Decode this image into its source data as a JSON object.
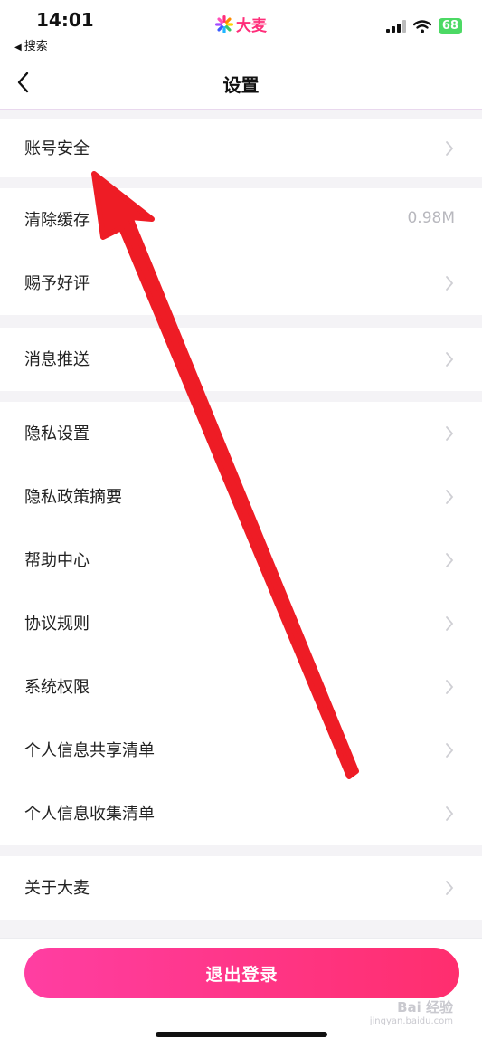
{
  "status_bar": {
    "time": "14:01",
    "back_app": "搜索",
    "battery": "68",
    "brand": "大麦"
  },
  "nav": {
    "title": "设置"
  },
  "sections": [
    {
      "items": [
        {
          "label": "账号安全"
        }
      ]
    },
    {
      "items": [
        {
          "label": "清除缓存",
          "value": "0.98M"
        },
        {
          "label": "赐予好评"
        }
      ]
    },
    {
      "items": [
        {
          "label": "消息推送"
        }
      ]
    },
    {
      "items": [
        {
          "label": "隐私设置"
        },
        {
          "label": "隐私政策摘要"
        },
        {
          "label": "帮助中心"
        },
        {
          "label": "协议规则"
        },
        {
          "label": "系统权限"
        },
        {
          "label": "个人信息共享清单"
        },
        {
          "label": "个人信息收集清单"
        }
      ]
    },
    {
      "items": [
        {
          "label": "关于大麦"
        }
      ]
    }
  ],
  "logout": {
    "label": "退出登录"
  },
  "watermark": {
    "main": "Bai 经验",
    "sub": "jingyan.baidu.com"
  },
  "colors": {
    "accent": "#ff2e7a",
    "annotation_arrow": "#ee1c25"
  }
}
